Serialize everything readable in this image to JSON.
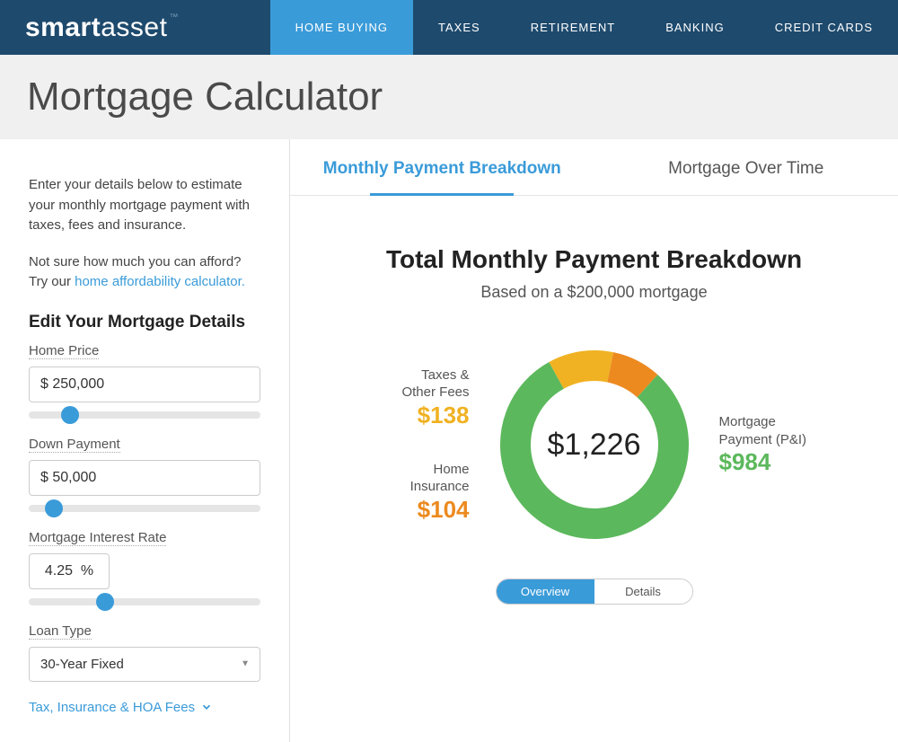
{
  "logo": {
    "part1": "smart",
    "part2": "asset",
    "tm": "™"
  },
  "nav": {
    "items": [
      "HOME BUYING",
      "TAXES",
      "RETIREMENT",
      "BANKING",
      "CREDIT CARDS"
    ],
    "activeIndex": 0
  },
  "pageTitle": "Mortgage Calculator",
  "sidebar": {
    "intro1": "Enter your details below to estimate your monthly mortgage payment with taxes, fees and insurance.",
    "intro2_prefix": "Not sure how much you can afford? Try our ",
    "intro2_link": "home affordability calculator.",
    "editTitle": "Edit Your Mortgage Details",
    "fields": {
      "homePrice": {
        "label": "Home Price",
        "value": "$ 250,000",
        "sliderPct": 14
      },
      "downPayment": {
        "label": "Down Payment",
        "value": "$ 50,000",
        "sliderPct": 7
      },
      "interestRate": {
        "label": "Mortgage Interest Rate",
        "value": "4.25  %",
        "sliderPct": 29
      },
      "loanType": {
        "label": "Loan Type",
        "value": "30-Year Fixed"
      }
    },
    "expandLink": "Tax, Insurance & HOA Fees"
  },
  "tabs": {
    "items": [
      "Monthly Payment Breakdown",
      "Mortgage Over Time"
    ],
    "activeIndex": 0
  },
  "breakdown": {
    "title": "Total Monthly Payment Breakdown",
    "subtitle": "Based on a $200,000 mortgage",
    "total": "$1,226",
    "taxes": {
      "label1": "Taxes &",
      "label2": "Other Fees",
      "value": "$138"
    },
    "insurance": {
      "label1": "Home",
      "label2": "Insurance",
      "value": "$104"
    },
    "mortgage": {
      "label1": "Mortgage",
      "label2": "Payment (P&I)",
      "value": "$984"
    }
  },
  "toggle": {
    "overview": "Overview",
    "details": "Details"
  },
  "chart_data": {
    "type": "donut",
    "title": "Total Monthly Payment Breakdown",
    "total": 1226,
    "series": [
      {
        "name": "Mortgage Payment (P&I)",
        "value": 984,
        "color": "#5cb85c"
      },
      {
        "name": "Taxes & Other Fees",
        "value": 138,
        "color": "#f0b223"
      },
      {
        "name": "Home Insurance",
        "value": 104,
        "color": "#ec8a1f"
      }
    ]
  }
}
